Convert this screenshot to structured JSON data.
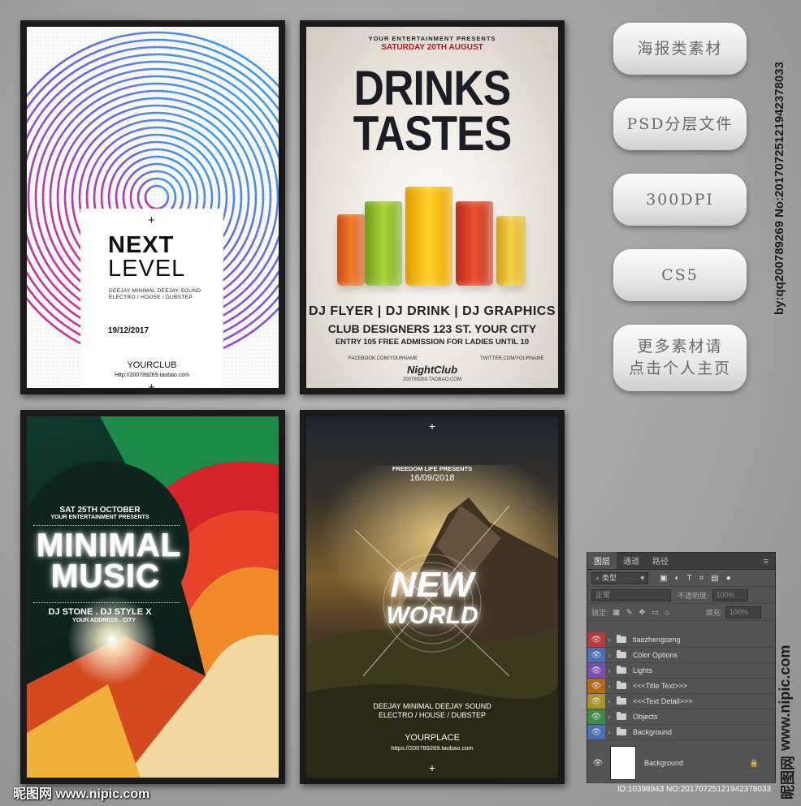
{
  "poster1": {
    "title_line1": "NEXT",
    "title_line2": "LEVEL",
    "line1": "DEEJAY MINIMAL DEEJAY SOUND",
    "line2": "ELECTRO / HOUSE / DUBSTEP",
    "date": "19/12/2017",
    "club": "YOURCLUB",
    "url": "Http://200789269.taobao.com",
    "plus": "+",
    "colors": {
      "ring_start": "#e8237d",
      "ring_end": "#2db5ec"
    }
  },
  "poster2": {
    "presents": "YOUR ENTERTAINMENT PRESENTS",
    "date": "SATURDAY 20TH AUGUST",
    "title_line1": "DRINKS",
    "title_line2": "TASTES",
    "dj_line": "DJ FLYER | DJ DRINK | DJ GRAPHICS",
    "club_line": "CLUB DESIGNERS 123 ST. YOUR CITY",
    "entry_line": "ENTRY 105 FREE ADMISSION FOR LADIES UNTIL 10",
    "facebook": "FACEBOOK.COM/YOURNAME",
    "twitter": "TWITTER.COM/YOURNAME",
    "nightclub": "NightClub",
    "url": "200789269.TAOBAO.COM",
    "glass_colors": [
      "#e8641b",
      "#8fbf2a",
      "#f4b400",
      "#d63b1f",
      "#e9b81c"
    ]
  },
  "poster3": {
    "date": "SAT 25TH OCTOBER",
    "presents": "YOUR ENTERTAINMENT PRESENTS",
    "title_line1": "MINIMAL",
    "title_line2": "MUSIC",
    "djs": "DJ STONE . DJ STYLE X",
    "address": "YOUR ADDRESS . CITY"
  },
  "poster4": {
    "presents": "FREEDOM LIFE PRESENTS",
    "date": "16/09/2018",
    "title_line1": "NEW",
    "title_line2": "WORLD",
    "line1": "DEEJAY MINIMAL DEEJAY SOUND",
    "line2": "ELECTRO / HOUSE / DUBSTEP",
    "place": "YOURPLACE",
    "url": "https://200789269.taobao.com",
    "plus": "+"
  },
  "side_buttons": [
    {
      "lines": [
        "海报类素材"
      ]
    },
    {
      "lines": [
        "PSD分层文件"
      ]
    },
    {
      "lines": [
        "300DPI"
      ]
    },
    {
      "lines": [
        "CS5"
      ]
    },
    {
      "lines": [
        "更多素材请",
        "点击个人主页"
      ]
    }
  ],
  "vertical_id": "by:qq200789269 No:20170725121942378033",
  "vertical_site": "www.nipic.com",
  "vertical_logo": "昵图网",
  "bottom_logo": "昵图网 www.nipic.com",
  "bottom_id": "ID:10398943 NO:20170725121942378033",
  "layers_panel": {
    "tabs": [
      "图层",
      "通道",
      "路径"
    ],
    "filter_label": "类型",
    "blend_mode": "正常",
    "opacity_label": "不透明度:",
    "opacity_value": "100%",
    "lock_label": "锁定:",
    "fill_label": "填充:",
    "fill_value": "100%",
    "layers": [
      {
        "name": "tiaozhengceng",
        "color": "#b83a3a"
      },
      {
        "name": "Color Options",
        "color": "#4a6fb5"
      },
      {
        "name": "Lights",
        "color": "#7b4fb0"
      },
      {
        "name": "<<<Title Text>>>",
        "color": "#b36a1c"
      },
      {
        "name": "<<<Text Detail>>>",
        "color": "#a8952a"
      },
      {
        "name": "Objects",
        "color": "#3f8a4a"
      },
      {
        "name": "Background",
        "color": "#4a6fb5"
      }
    ],
    "bg_layer": "Background",
    "menu_icon": "hamburger-icon"
  }
}
